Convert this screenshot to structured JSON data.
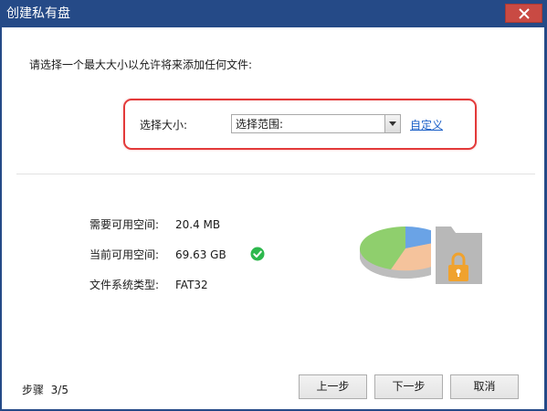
{
  "window": {
    "title": "创建私有盘"
  },
  "prompt": "请选择一个最大大小以允许将来添加任何文件:",
  "size_selector": {
    "label": "选择大小:",
    "value": "选择范围:",
    "custom_link": "自定义"
  },
  "info": {
    "required_label": "需要可用空间:",
    "required_value": "20.4 MB",
    "current_label": "当前可用空间:",
    "current_value": "69.63 GB",
    "fs_label": "文件系统类型:",
    "fs_value": "FAT32"
  },
  "footer": {
    "step_label": "步骤",
    "step_value": "3/5",
    "back_label": "上一步",
    "next_label": "下一步",
    "cancel_label": "取消"
  },
  "colors": {
    "titlebar": "#254a87",
    "close": "#c94a43",
    "highlight": "#e33a3a",
    "link": "#1a5fc7",
    "check": "#2db84d",
    "lock": "#f0a22e"
  },
  "icons": [
    "close-icon",
    "dropdown-arrow-icon",
    "check-icon",
    "pie-chart-icon",
    "folder-icon",
    "lock-icon"
  ]
}
